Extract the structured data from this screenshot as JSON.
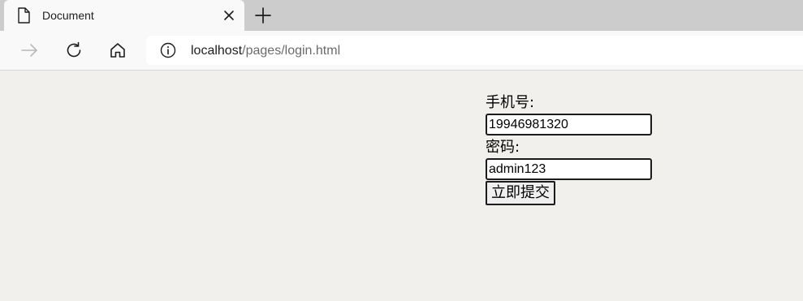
{
  "browser": {
    "tab": {
      "title": "Document"
    },
    "address": {
      "host": "localhost",
      "path": "/pages/login.html"
    }
  },
  "form": {
    "phone_label": "手机号:",
    "phone_value": "19946981320",
    "password_label": "密码:",
    "password_value": "admin123",
    "submit_label": "立即提交"
  },
  "icons": {
    "tab": "document-icon",
    "close": "close-icon",
    "new_tab": "plus-icon",
    "forward": "forward-arrow-icon",
    "reload": "reload-icon",
    "home": "home-icon",
    "info": "info-icon"
  },
  "colors": {
    "tabstrip_bg": "#cccccc",
    "toolbar_bg": "#f9f9f9",
    "page_bg": "#f1f0ed",
    "url_path": "#6b6b6b"
  }
}
